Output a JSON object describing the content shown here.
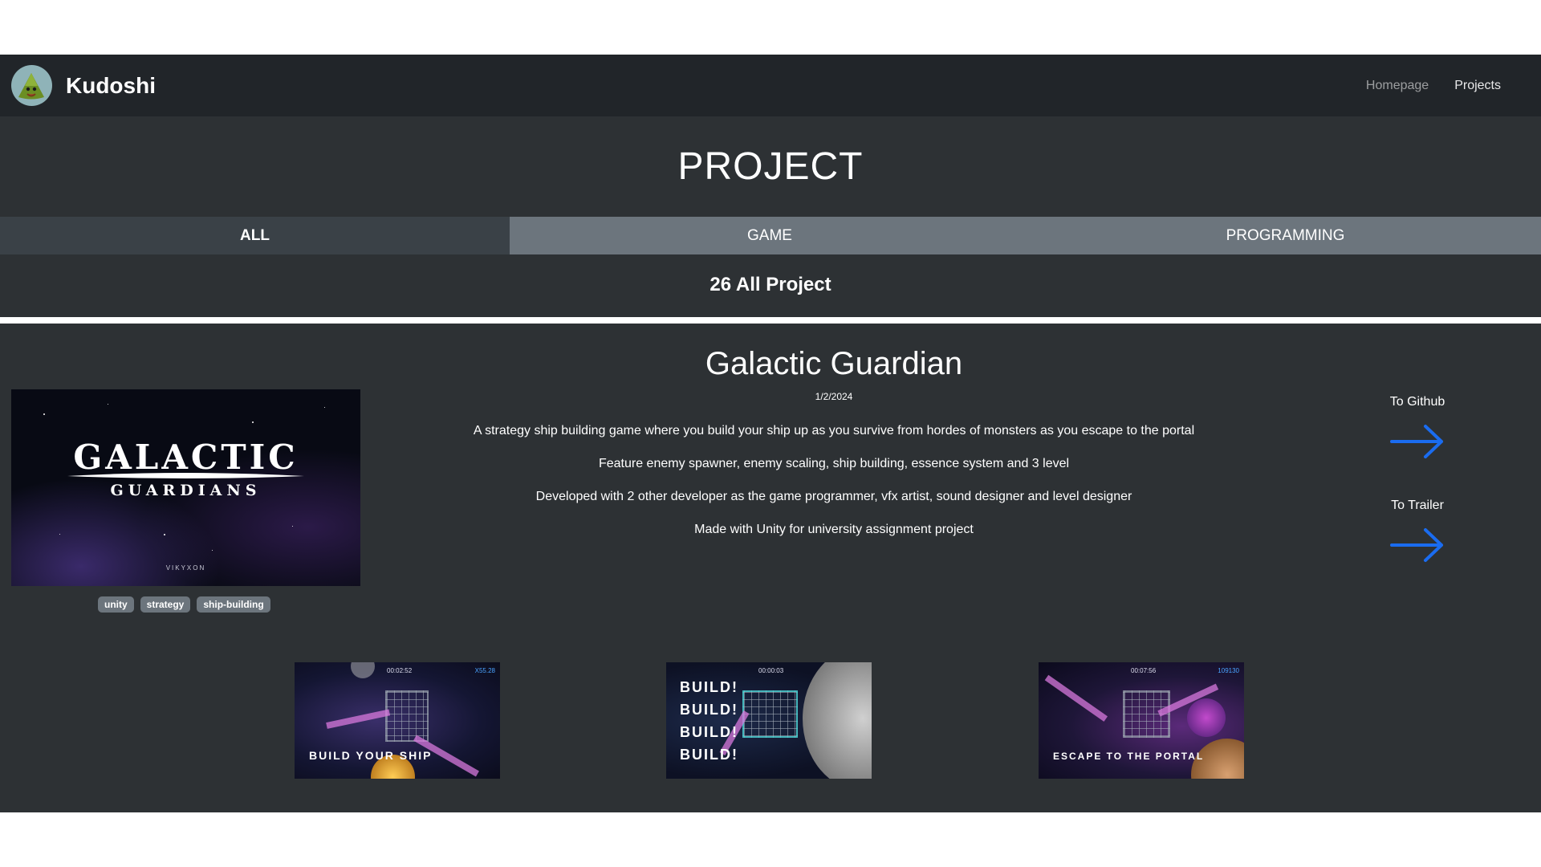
{
  "navbar": {
    "brand": "Kudoshi",
    "links": [
      "Homepage",
      "Projects"
    ]
  },
  "header": {
    "title": "PROJECT",
    "tabs": [
      "ALL",
      "GAME",
      "PROGRAMMING"
    ],
    "active_tab": "ALL",
    "count_text": "26 All Project"
  },
  "project": {
    "title": "Galactic Guardian",
    "date": "1/2/2024",
    "descriptions": [
      "A strategy ship building game where you build your ship up as you survive from hordes of monsters as you escape to the portal",
      "Feature enemy spawner, enemy scaling, ship building, essence system and 3 level",
      "Developed with 2 other developer as the game programmer, vfx artist, sound designer and level designer",
      "Made with Unity for university assignment project"
    ],
    "cover": {
      "title": "GALACTIC",
      "subtitle": "GUARDIANS",
      "studio": "VIKYXON"
    },
    "tags": [
      "unity",
      "strategy",
      "ship-building"
    ],
    "links": {
      "github": "To Github",
      "trailer": "To Trailer"
    },
    "screenshots": [
      {
        "caption": "BUILD YOUR SHIP",
        "timer": "00:02:52",
        "score": "X55.28"
      },
      {
        "caption_lines": [
          "BUILD!",
          "BUILD!",
          "BUILD!",
          "BUILD!"
        ],
        "timer": "00:00:03"
      },
      {
        "caption": "ESCAPE TO THE PORTAL",
        "timer": "00:07:56",
        "score": "109130"
      }
    ]
  },
  "colors": {
    "navbar_bg": "#212529",
    "section_bg": "#2d3134",
    "tab_active": "#3a4147",
    "tab_inactive": "#6c757d",
    "arrow": "#1a6cf0"
  }
}
